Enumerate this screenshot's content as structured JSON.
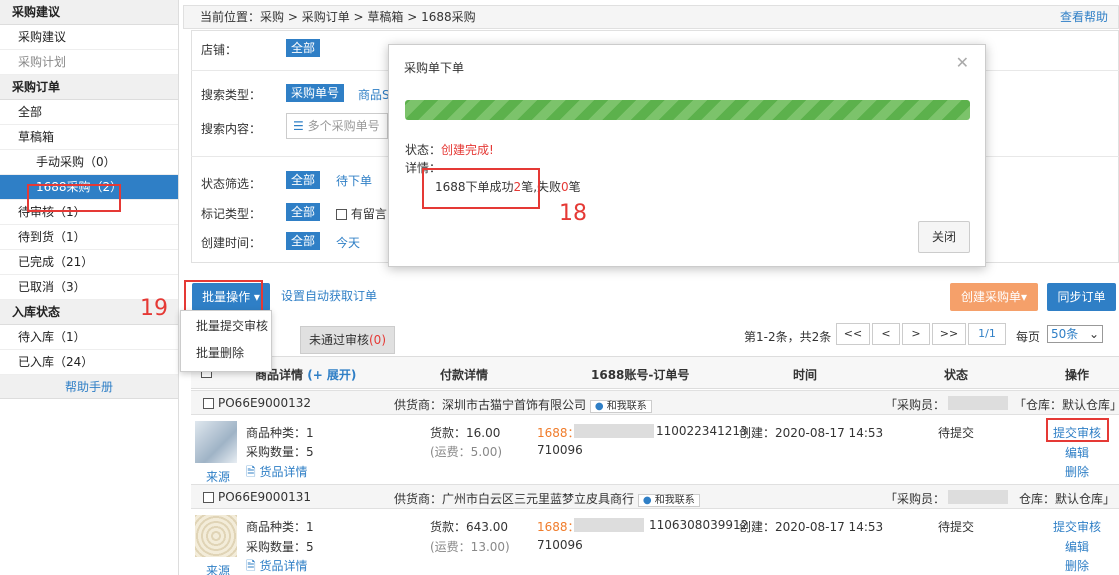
{
  "sidebar": {
    "sections": [
      {
        "title": "采购建议",
        "items": [
          {
            "label": "采购建议"
          },
          {
            "label": "采购计划",
            "muted": true
          }
        ]
      },
      {
        "title": "采购订单",
        "items": [
          {
            "label": "全部"
          },
          {
            "label": "草稿箱"
          },
          {
            "label": "手动采购（0）",
            "sub": true
          },
          {
            "label": "1688采购（2）",
            "sub": true,
            "active": true
          },
          {
            "label": "待审核（1）"
          },
          {
            "label": "待到货（1）"
          },
          {
            "label": "已完成（21）"
          },
          {
            "label": "已取消（3）"
          }
        ]
      },
      {
        "title": "入库状态",
        "items": [
          {
            "label": "待入库（1）"
          },
          {
            "label": "已入库（24）"
          }
        ]
      }
    ],
    "help": "帮助手册"
  },
  "breadcrumb": {
    "prefix": "当前位置：",
    "path": "采购 > 采购订单 > 草稿箱 > 1688采购",
    "help": "查看帮助"
  },
  "filters": {
    "shop_label": "店铺：",
    "shop_value": "全部",
    "search_type_label": "搜索类型：",
    "search_type_value": "采购单号",
    "search_type_other": "商品S",
    "search_content_label": "搜索内容：",
    "search_placeholder": "多个采购单号",
    "status_label": "状态筛选：",
    "status_all": "全部",
    "status_pending": "待下单",
    "mark_label": "标记类型：",
    "mark_all": "全部",
    "mark_comment": "有留言",
    "time_label": "创建时间：",
    "time_all": "全部",
    "time_today": "今天"
  },
  "toolbar": {
    "batch": "批量操作",
    "auto": "设置自动获取订单",
    "create": "创建采购单▾",
    "sync": "同步订单",
    "menu": [
      "批量提交审核",
      "批量删除"
    ]
  },
  "tabs": {
    "rejected": "未通过审核",
    "rejected_count": "(0)"
  },
  "pagination": {
    "summary": "第1-2条，共2条",
    "first": "<<",
    "prev": "<",
    "next": ">",
    "last": ">>",
    "page": "1/1",
    "per_label": "每页",
    "per_value": "50条"
  },
  "table": {
    "headers": {
      "product": "商品详情",
      "expand": "(+ 展开)",
      "payment": "付款详情",
      "account": "1688账号-订单号",
      "time": "时间",
      "status": "状态",
      "ops": "操作"
    },
    "orders": [
      {
        "po": "PO66E9000132",
        "supplier_label": "供货商：",
        "supplier": "深圳市古猫宁首饰有限公司",
        "contact": "和我联系",
        "buyer": "「采购员：",
        "warehouse": "「仓库：默认仓库」",
        "kinds": "商品种类：1",
        "qty": "采购数量：5",
        "detail": "货品详情",
        "source": "来源",
        "amount": "货款：16.00",
        "freight": "(运费：5.00)",
        "acct": "1688：",
        "order_no_tail": "110022341213",
        "order_no2": "710096",
        "created": "创建：2020-08-17 14:53",
        "status": "待提交",
        "op_submit": "提交审核",
        "op_edit": "编辑",
        "op_delete": "删除"
      },
      {
        "po": "PO66E9000131",
        "supplier_label": "供货商：",
        "supplier": "广州市白云区三元里蓝梦立皮具商行",
        "contact": "和我联系",
        "buyer": "「采购员：",
        "warehouse": "仓库：默认仓库」",
        "kinds": "商品种类：1",
        "qty": "采购数量：5",
        "detail": "货品详情",
        "source": "来源",
        "amount": "货款：643.00",
        "freight": "(运费：13.00)",
        "acct": "1688：",
        "order_no_tail": "1106308039912",
        "order_no2": "710096",
        "created": "创建：2020-08-17 14:53",
        "status": "待提交",
        "op_submit": "提交审核",
        "op_edit": "编辑",
        "op_delete": "删除"
      }
    ]
  },
  "modal": {
    "title": "采购单下单",
    "progress": 1.0,
    "status_label": "状态：",
    "status_value": "创建完成!",
    "detail_label": "详情：",
    "detail_pre": "1688下单成功",
    "success": "2",
    "detail_mid": "笔,失败",
    "fail": "0",
    "detail_post": "笔",
    "close": "关闭"
  },
  "annotations": {
    "a18": "18",
    "a19": "19"
  },
  "colors": {
    "accent": "#2f7fc6",
    "orange": "#f5a06a",
    "red": "#e53935",
    "progress": "#5cb14c"
  }
}
